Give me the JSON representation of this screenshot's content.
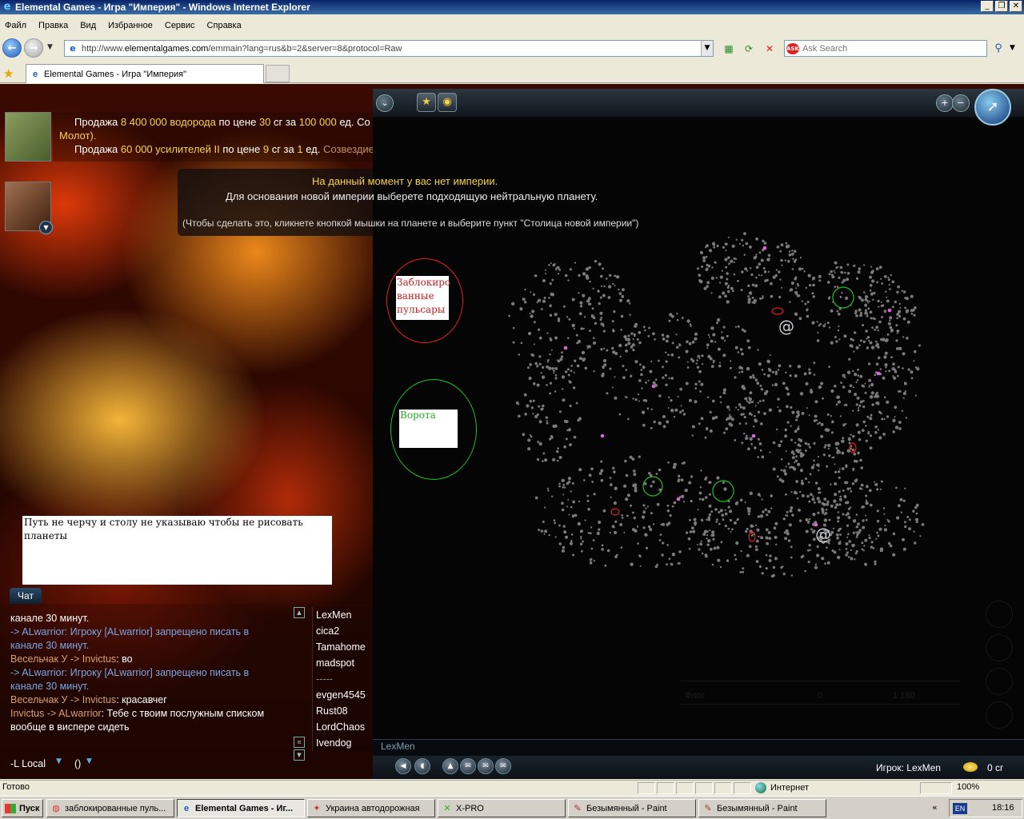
{
  "window": {
    "title": "Elemental Games - Игра \"Империя\" - Windows Internet Explorer",
    "buttons": [
      "_",
      "❐",
      "✕"
    ]
  },
  "menu": [
    "Файл",
    "Правка",
    "Вид",
    "Избранное",
    "Сервис",
    "Справка"
  ],
  "address": {
    "url_prefix": "http://www.",
    "url_host": "elementalgames.com",
    "url_path": "/emmain?lang=rus&b=2&server=8&protocol=Raw"
  },
  "search": {
    "placeholder": "Ask Search",
    "logo": "ASK"
  },
  "tab": {
    "label": "Elemental Games - Игра \"Империя\""
  },
  "trades": [
    {
      "w1": "Продажа",
      "amount": "8 400 000",
      "item": "водорода",
      "w2": "по цене",
      "price": "30",
      "w3": "сг за",
      "qty": "100 000",
      "w4": "ед.",
      "tail": "Co",
      "line2": "Молот)."
    },
    {
      "w1": "Продажа",
      "amount": "60 000",
      "item": "усилителей II",
      "w2": "по цене",
      "price": "9",
      "w3": "сг за",
      "qty": "1",
      "w4": "ед.",
      "tail": "Созвездие gromoglaz (Клан"
    }
  ],
  "notice": {
    "title": "На данный момент у вас нет империи.",
    "line1": "Для основания новой империи выберете подходящую нейтральную планету.",
    "line2": "(Чтобы сделать это, кликнете кнопкой мышки на планете и выберите пункт \"Столица новой империи\")"
  },
  "annotations": {
    "red": [
      "Заблокиро",
      "ванные",
      "пульсары"
    ],
    "green": "Ворота",
    "note": "Путь не черчу и столу не указываю чтобы не рисовать планеты"
  },
  "game": {
    "player_bottom": "LexMen",
    "player_label": "Игрок: LexMen",
    "credits": "0 сг",
    "ghost": {
      "fleet": "Флот",
      "v1": "0",
      "v2": "1 180"
    }
  },
  "chat": {
    "tab": "Чат",
    "messages": [
      [
        {
          "t": "канале 30 минут.",
          "c": ""
        }
      ],
      [
        {
          "t": " -> ALwarrior",
          "c": "sys"
        },
        {
          "t": ": Игроку [ALwarrior] запрещено писать в",
          "c": "sys"
        }
      ],
      [
        {
          "t": "канале 30 минут.",
          "c": "sys"
        }
      ],
      [
        {
          "t": "Весельчак У -> Invictus",
          "c": "nm"
        },
        {
          "t": ": во",
          "c": ""
        }
      ],
      [
        {
          "t": " -> ALwarrior",
          "c": "sys"
        },
        {
          "t": ": Игроку [ALwarrior] запрещено писать в",
          "c": "sys"
        }
      ],
      [
        {
          "t": "канале 30 минут.",
          "c": "sys"
        }
      ],
      [
        {
          "t": "Весельчак У -> Invictus",
          "c": "nm"
        },
        {
          "t": ": красавчег",
          "c": ""
        }
      ],
      [
        {
          "t": "Invictus -> ALwarrior",
          "c": "nm"
        },
        {
          "t": ": Тебе с твоим послужным списком",
          "c": ""
        }
      ],
      [
        {
          "t": "вообще в виспере сидеть",
          "c": ""
        }
      ]
    ],
    "users": [
      "LexMen",
      "cica2",
      "Tamahome",
      "madspot",
      "-----",
      "evgen4545",
      "Rust08",
      "LordChaos",
      "Ivendog"
    ],
    "channel": "-L Local",
    "paren": "()"
  },
  "status": {
    "text": "Готово",
    "zone": "Интернет",
    "zoom": "100%"
  },
  "taskbar": {
    "start": "Пуск",
    "tasks": [
      {
        "label": "заблокированные пуль...",
        "icon": "chrome-icon",
        "active": false
      },
      {
        "label": "Elemental Games - Иг...",
        "icon": "ie-icon",
        "active": true
      },
      {
        "label": "Украина автодорожная",
        "icon": "map-icon",
        "active": false
      },
      {
        "label": "X-PRO",
        "icon": "xpro-icon",
        "active": false
      },
      {
        "label": "Безымянный - Paint",
        "icon": "paint-icon",
        "active": false
      },
      {
        "label": "Безымянный - Paint",
        "icon": "paint-icon",
        "active": false
      }
    ],
    "lang": "EN",
    "clock": "18:16"
  }
}
